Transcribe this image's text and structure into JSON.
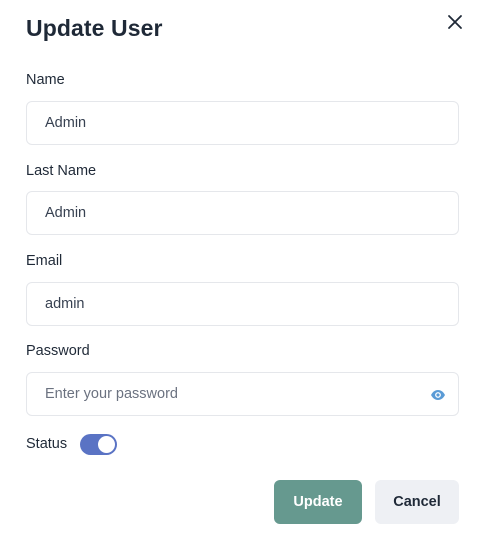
{
  "dialog": {
    "title": "Update User",
    "close_icon": "close-icon"
  },
  "form": {
    "name": {
      "label": "Name",
      "value": "Admin"
    },
    "last_name": {
      "label": "Last Name",
      "value": "Admin"
    },
    "email": {
      "label": "Email",
      "value": "admin"
    },
    "password": {
      "label": "Password",
      "value": "",
      "placeholder": "Enter your password",
      "toggle_icon": "eye-icon"
    },
    "status": {
      "label": "Status",
      "enabled": true
    }
  },
  "actions": {
    "update_label": "Update",
    "cancel_label": "Cancel"
  },
  "colors": {
    "primary_button": "#66998f",
    "toggle_on": "#5a73c4",
    "eye_icon": "#5a9bd6",
    "cancel_button_bg": "#eef0f4"
  }
}
